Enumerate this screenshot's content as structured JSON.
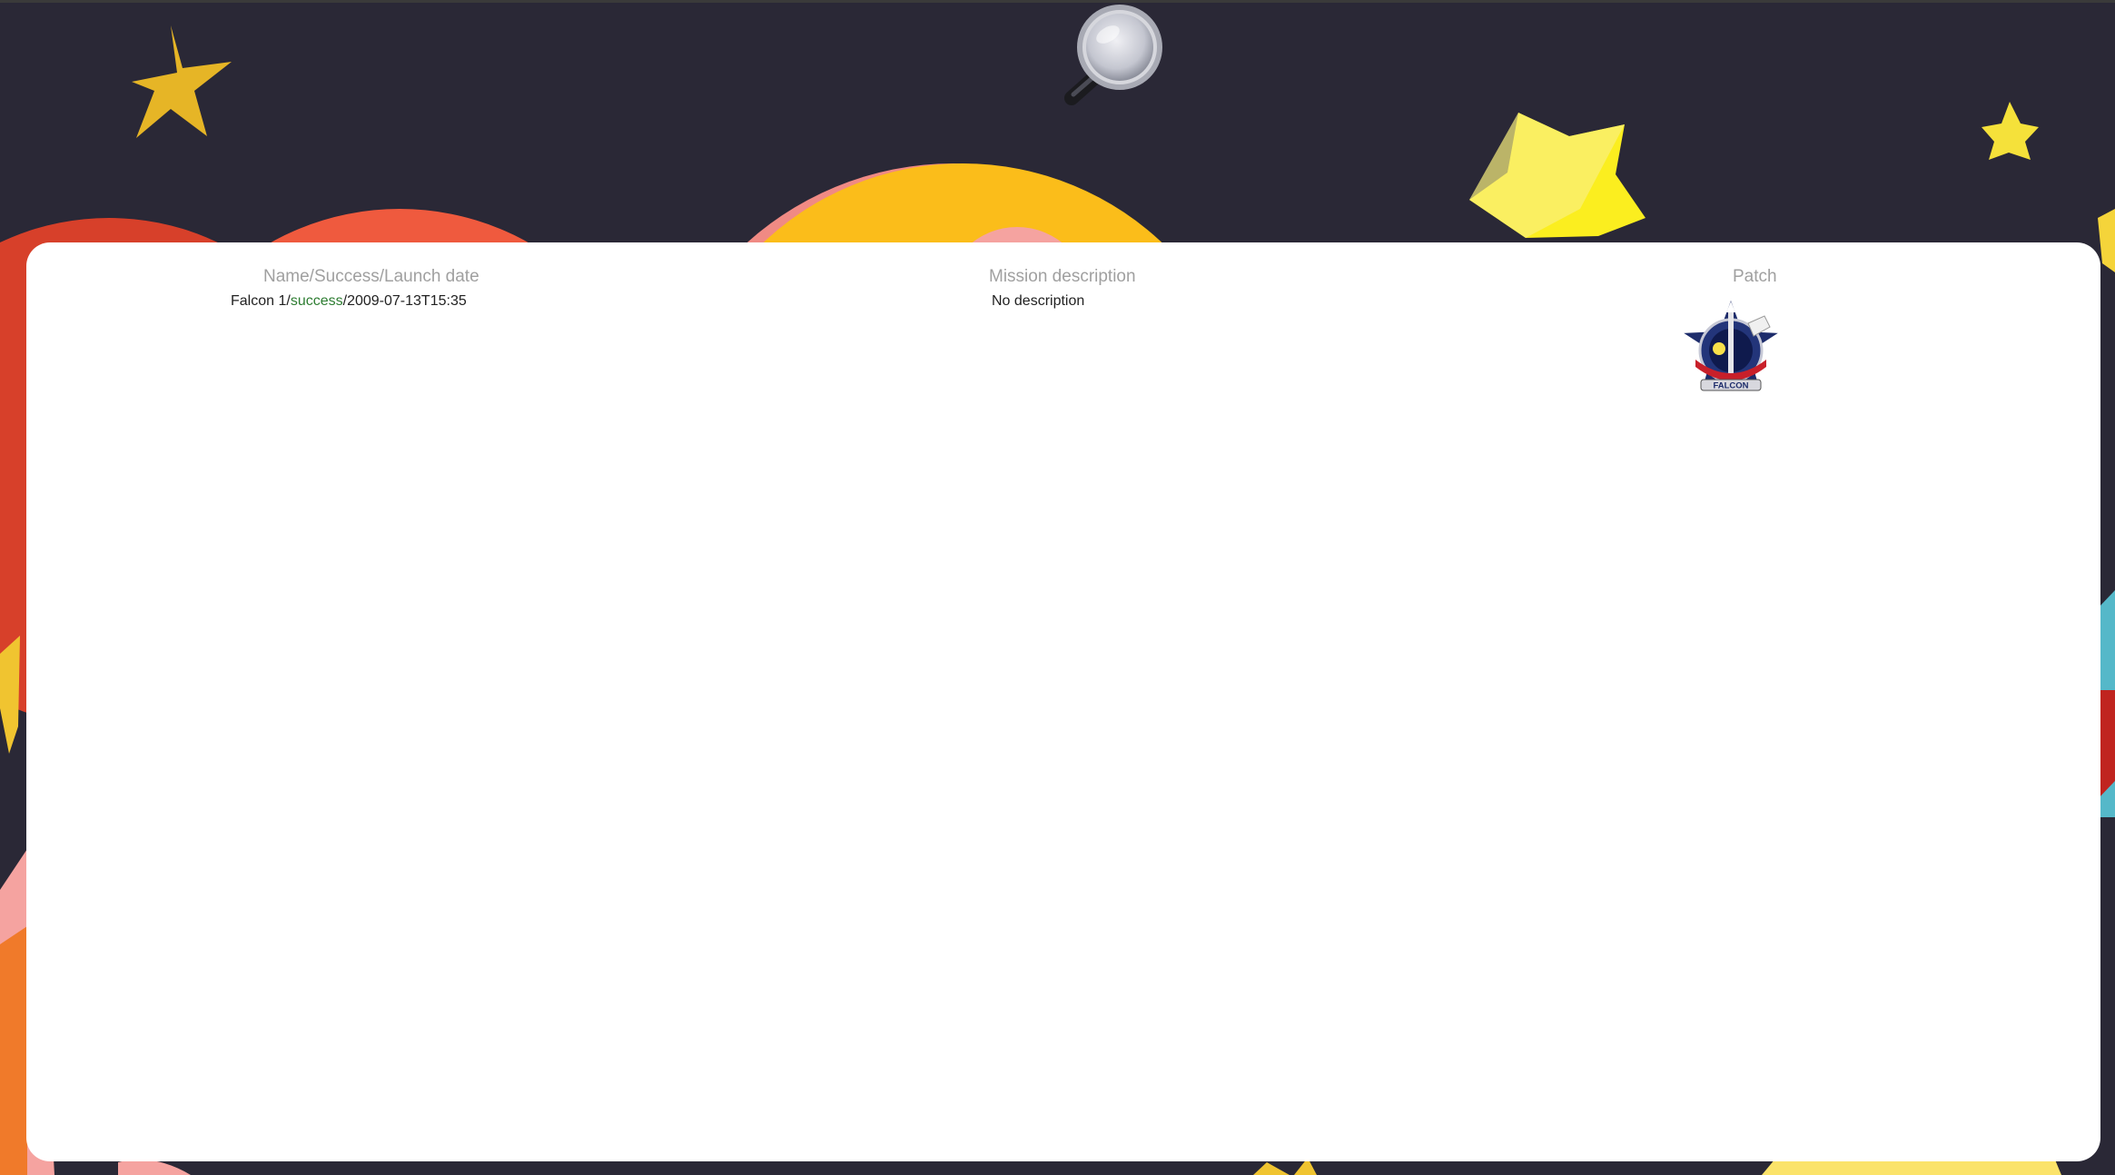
{
  "colors": {
    "background": "#2a2836",
    "panel": "#ffffff",
    "header_text": "#a0a0a0",
    "success": "#2e7d32"
  },
  "search": {
    "icon": "magnifying-glass-icon"
  },
  "table": {
    "headers": {
      "name": "Name/Success/Launch date",
      "description": "Mission description",
      "patch": "Patch"
    },
    "rows": [
      {
        "name": "Falcon 1",
        "status": "success",
        "launch_date": "2009-07-13T15:35",
        "description": "No description",
        "patch_icon": "falcon-mission-patch",
        "patch_label": "FALCON"
      }
    ]
  }
}
